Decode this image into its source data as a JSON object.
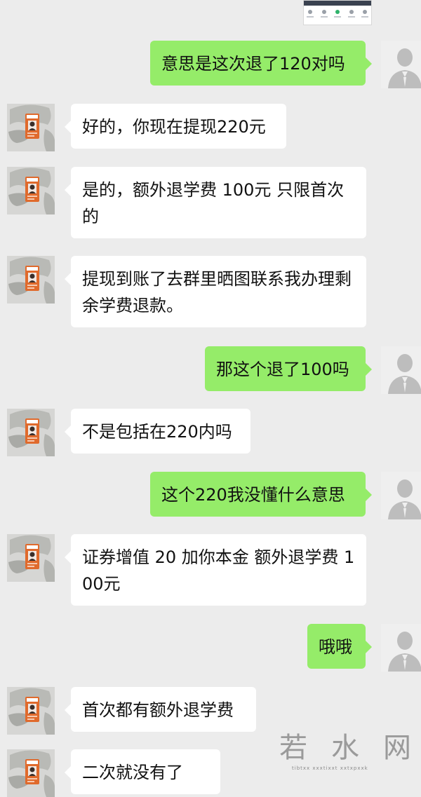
{
  "screenshot_thumbnail": {
    "tabs": [
      "tab",
      "tab",
      "tab",
      "tab",
      "tab"
    ]
  },
  "messages": [
    {
      "side": "out",
      "text": "意思是这次退了120对吗"
    },
    {
      "side": "in",
      "text": "好的，你现在提现220元"
    },
    {
      "side": "in",
      "text": "是的，额外退学费 100元 只限首次的"
    },
    {
      "side": "in",
      "text": "提现到账了去群里晒图联系我办理剩余学费退款。"
    },
    {
      "side": "out",
      "text": "那这个退了100吗"
    },
    {
      "side": "in",
      "text": "不是包括在220内吗"
    },
    {
      "side": "out",
      "text": "这个220我没懂什么意思"
    },
    {
      "side": "in",
      "text": "证券增值 20 加你本金 额外退学费 100元"
    },
    {
      "side": "out",
      "text": "哦哦"
    },
    {
      "side": "in",
      "text": "首次都有额外退学费"
    },
    {
      "side": "in",
      "text": "二次就没有了"
    }
  ],
  "watermark": {
    "logo_text": "若水网",
    "tagline": "tibtxx  xxxtixxt  xxtxpxxk"
  },
  "colors": {
    "background": "#ececec",
    "incoming_bubble": "#ffffff",
    "outgoing_bubble": "#95ec69"
  }
}
